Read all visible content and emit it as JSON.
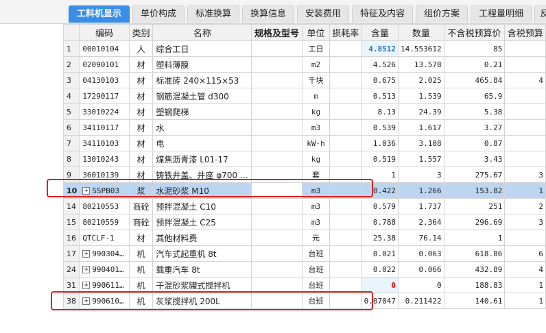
{
  "tabs": [
    {
      "label": "工料机显示",
      "active": true
    },
    {
      "label": "单价构成"
    },
    {
      "label": "标准换算"
    },
    {
      "label": "换算信息"
    },
    {
      "label": "安装费用"
    },
    {
      "label": "特征及内容"
    },
    {
      "label": "组价方案"
    },
    {
      "label": "工程量明细"
    },
    {
      "label": "反"
    }
  ],
  "columns": [
    "编码",
    "类别",
    "名称",
    "规格及型号",
    "单位",
    "损耗率",
    "含量",
    "数量",
    "不含税预算价",
    "含税预算"
  ],
  "rows": [
    {
      "no": "1",
      "code": "00010104",
      "type": "人",
      "name": "综合工日",
      "spec": "",
      "unit": "工日",
      "loss": "",
      "content": "4.8512",
      "qty": "14.553612",
      "price": "85",
      "taxprice": ""
    },
    {
      "no": "2",
      "code": "02090101",
      "type": "材",
      "name": "塑料薄膜",
      "spec": "",
      "unit": "m2",
      "loss": "",
      "content": "4.526",
      "qty": "13.578",
      "price": "0.21",
      "taxprice": ""
    },
    {
      "no": "3",
      "code": "04130103",
      "type": "材",
      "name": "标准砖 240×115×53",
      "spec": "",
      "unit": "千块",
      "loss": "",
      "content": "0.675",
      "qty": "2.025",
      "price": "465.84",
      "taxprice": "4"
    },
    {
      "no": "4",
      "code": "17290117",
      "type": "材",
      "name": "钢筋混凝土管 d300",
      "spec": "",
      "unit": "m",
      "loss": "",
      "content": "0.513",
      "qty": "1.539",
      "price": "65.9",
      "taxprice": ""
    },
    {
      "no": "5",
      "code": "33010224",
      "type": "材",
      "name": "塑钢爬梯",
      "spec": "",
      "unit": "kg",
      "loss": "",
      "content": "8.13",
      "qty": "24.39",
      "price": "5.38",
      "taxprice": ""
    },
    {
      "no": "6",
      "code": "34110117",
      "type": "材",
      "name": "水",
      "spec": "",
      "unit": "m3",
      "loss": "",
      "content": "0.539",
      "qty": "1.617",
      "price": "3.27",
      "taxprice": ""
    },
    {
      "no": "7",
      "code": "34110103",
      "type": "材",
      "name": "电",
      "spec": "",
      "unit": "kW·h",
      "loss": "",
      "content": "1.036",
      "qty": "3.108",
      "price": "0.87",
      "taxprice": ""
    },
    {
      "no": "8",
      "code": "13010243",
      "type": "材",
      "name": "煤焦沥青漆 L01-17",
      "spec": "",
      "unit": "kg",
      "loss": "",
      "content": "0.519",
      "qty": "1.557",
      "price": "3.43",
      "taxprice": ""
    },
    {
      "no": "9",
      "code": "36010139",
      "type": "材",
      "name": "铸铁井盖、井座 φ700 …",
      "spec": "",
      "unit": "套",
      "loss": "",
      "content": "1",
      "qty": "3",
      "price": "275.67",
      "taxprice": "3"
    },
    {
      "no": "10",
      "code": "SSPB03",
      "type": "浆",
      "name": "水泥砂浆 M10",
      "spec": "",
      "unit": "m3",
      "loss": "",
      "content": "0.422",
      "qty": "1.266",
      "price": "153.82",
      "taxprice": "1",
      "expand": true,
      "selected": true
    },
    {
      "no": "14",
      "code": "80210553",
      "type": "商砼",
      "name": "预拌混凝土 C10",
      "spec": "",
      "unit": "m3",
      "loss": "",
      "content": "0.579",
      "qty": "1.737",
      "price": "251",
      "taxprice": "2"
    },
    {
      "no": "15",
      "code": "80210559",
      "type": "商砼",
      "name": "预拌混凝土 C25",
      "spec": "",
      "unit": "m3",
      "loss": "",
      "content": "0.788",
      "qty": "2.364",
      "price": "296.69",
      "taxprice": "3"
    },
    {
      "no": "16",
      "code": "QTCLF-1",
      "type": "材",
      "name": "其他材料费",
      "spec": "",
      "unit": "元",
      "loss": "",
      "content": "25.38",
      "qty": "76.14",
      "price": "1",
      "taxprice": ""
    },
    {
      "no": "17",
      "code": "990304…",
      "type": "机",
      "name": "汽车式起重机 8t",
      "spec": "",
      "unit": "台班",
      "loss": "",
      "content": "0.021",
      "qty": "0.063",
      "price": "618.86",
      "taxprice": "6",
      "expand": true
    },
    {
      "no": "24",
      "code": "990401…",
      "type": "机",
      "name": "载重汽车 8t",
      "spec": "",
      "unit": "台班",
      "loss": "",
      "content": "0.022",
      "qty": "0.066",
      "price": "432.89",
      "taxprice": "4",
      "expand": true
    },
    {
      "no": "31",
      "code": "990611…",
      "type": "机",
      "name": "干混砂浆罐式搅拌机",
      "spec": "",
      "unit": "台班",
      "loss": "",
      "content": "0",
      "qty": "0",
      "price": "188.83",
      "taxprice": "1",
      "expand": true
    },
    {
      "no": "38",
      "code": "990610…",
      "type": "机",
      "name": "灰浆搅拌机 200L",
      "spec": "",
      "unit": "台班",
      "loss": "",
      "content": "0.07047",
      "qty": "0.211422",
      "price": "140.61",
      "taxprice": "1",
      "expand": true
    }
  ],
  "colors": {
    "accent": "#3a8ee6",
    "selected_row": "#bcd6f2",
    "annotation": "#e02020",
    "value_blue": "#2c6fcf",
    "value_red": "#e00000"
  }
}
